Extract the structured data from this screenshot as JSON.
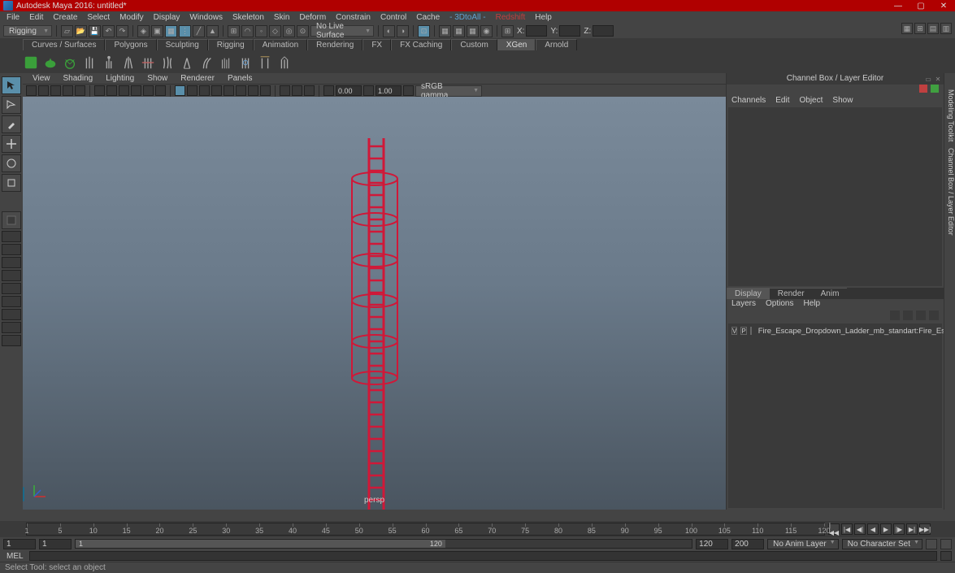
{
  "titlebar": {
    "text": "Autodesk Maya 2016: untitled*"
  },
  "menubar": {
    "items": [
      "File",
      "Edit",
      "Create",
      "Select",
      "Modify",
      "Display",
      "Windows",
      "Skeleton",
      "Skin",
      "Deform",
      "Constrain",
      "Control",
      "Cache"
    ],
    "extra": [
      "- 3DtoAll -",
      "Redshift",
      "Help"
    ]
  },
  "toolbar": {
    "workspace": "Rigging",
    "surface": "No Live Surface",
    "coords": {
      "x": "X:",
      "y": "Y:",
      "z": "Z:"
    }
  },
  "shelf": {
    "tabs": [
      "Curves / Surfaces",
      "Polygons",
      "Sculpting",
      "Rigging",
      "Animation",
      "Rendering",
      "FX",
      "FX Caching",
      "Custom",
      "XGen",
      "Arnold"
    ],
    "active": "XGen"
  },
  "panel": {
    "menus": [
      "View",
      "Shading",
      "Lighting",
      "Show",
      "Renderer",
      "Panels"
    ],
    "exposure": "0.00",
    "gamma": "1.00",
    "colorspace": "sRGB gamma",
    "label": "persp"
  },
  "channelbox": {
    "title": "Channel Box / Layer Editor",
    "menus": [
      "Channels",
      "Edit",
      "Object",
      "Show"
    ]
  },
  "layereditor": {
    "tabs": [
      "Display",
      "Render",
      "Anim"
    ],
    "menus": [
      "Layers",
      "Options",
      "Help"
    ],
    "layer": {
      "vis": "V",
      "play": "P",
      "name": "Fire_Escape_Dropdown_Ladder_mb_standart:Fire_Escape"
    }
  },
  "sidebars": {
    "right": [
      "Modeling Toolkit",
      "Channel Box / Layer Editor"
    ]
  },
  "timeslider": {
    "ticks": [
      "1",
      "5",
      "10",
      "15",
      "20",
      "25",
      "30",
      "35",
      "40",
      "45",
      "50",
      "55",
      "60",
      "65",
      "70",
      "75",
      "80",
      "85",
      "90",
      "95",
      "100",
      "105",
      "110",
      "115",
      "120"
    ]
  },
  "range": {
    "startOuter": "1",
    "startInner": "1",
    "trackStart": "1",
    "trackEnd": "120",
    "endInner": "120",
    "endOuter": "200",
    "animLayer": "No Anim Layer",
    "charSet": "No Character Set"
  },
  "cmd": {
    "label": "MEL"
  },
  "status": {
    "text": "Select Tool: select an object"
  }
}
